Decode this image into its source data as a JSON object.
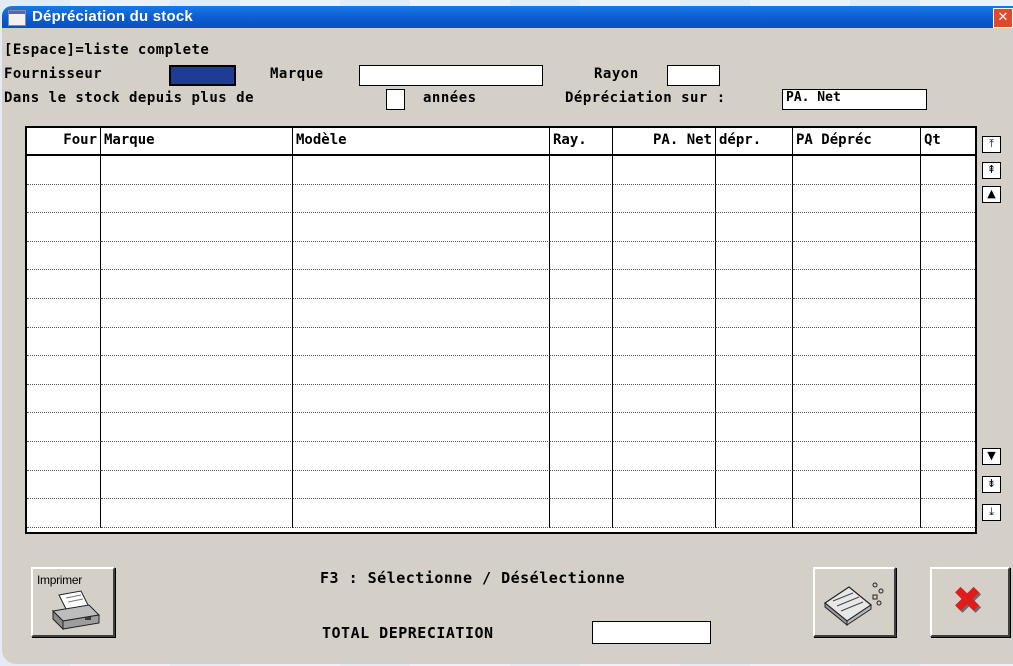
{
  "window": {
    "title": "Dépréciation du stock",
    "close_glyph": "✕"
  },
  "hint": "[Espace]=liste complete",
  "filters": {
    "fournisseur_label": "Fournisseur",
    "fournisseur_value": "",
    "marque_label": "Marque",
    "marque_value": "",
    "rayon_label": "Rayon",
    "rayon_value": "",
    "stock_prefix": "Dans le stock depuis plus de",
    "annees_value": "",
    "annees_suffix": "années",
    "depreciation_label": "Dépréciation sur :",
    "depreciation_value": "PA. Net"
  },
  "table": {
    "columns": [
      "Four",
      "Marque",
      "Modèle",
      "Ray.",
      "PA. Net",
      "dépr.",
      "PA Dépréc",
      "Qt"
    ],
    "rows": [
      [
        "",
        "",
        "",
        "",
        "",
        "",
        "",
        ""
      ],
      [
        "",
        "",
        "",
        "",
        "",
        "",
        "",
        ""
      ],
      [
        "",
        "",
        "",
        "",
        "",
        "",
        "",
        ""
      ],
      [
        "",
        "",
        "",
        "",
        "",
        "",
        "",
        ""
      ],
      [
        "",
        "",
        "",
        "",
        "",
        "",
        "",
        ""
      ],
      [
        "",
        "",
        "",
        "",
        "",
        "",
        "",
        ""
      ],
      [
        "",
        "",
        "",
        "",
        "",
        "",
        "",
        ""
      ],
      [
        "",
        "",
        "",
        "",
        "",
        "",
        "",
        ""
      ],
      [
        "",
        "",
        "",
        "",
        "",
        "",
        "",
        ""
      ],
      [
        "",
        "",
        "",
        "",
        "",
        "",
        "",
        ""
      ],
      [
        "",
        "",
        "",
        "",
        "",
        "",
        "",
        ""
      ],
      [
        "",
        "",
        "",
        "",
        "",
        "",
        "",
        ""
      ],
      [
        "",
        "",
        "",
        "",
        "",
        "",
        "",
        ""
      ]
    ]
  },
  "scrollbar": {
    "top": "⤒",
    "page_up": "⇞",
    "line_up": "▲",
    "line_down": "▼",
    "page_down": "⇟",
    "bottom": "⤓"
  },
  "footer": {
    "f3_text": "F3 : Sélectionne / Désélectionne",
    "total_label": "TOTAL DEPRECIATION",
    "total_value": "",
    "print_label": "Imprimer",
    "cancel_glyph": "✖"
  },
  "colors": {
    "title_bar": "#0b5cd0",
    "active_field": "#1c3d93",
    "cancel_red": "#e01b1b",
    "window_bg": "#d4d0c8"
  }
}
